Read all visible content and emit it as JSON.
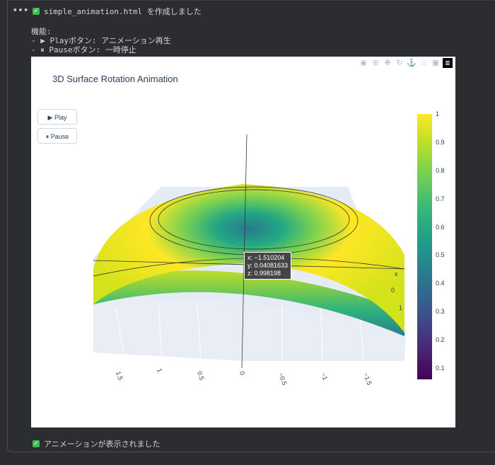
{
  "output": {
    "more": "•••",
    "status_line": "simple_animation.html を作成しました",
    "features_header": "機能:",
    "feature_items": [
      "- ▶ Playボタン: アニメーション再生",
      "- ⏸ Pauseボタン: 一時停止"
    ],
    "final_status": "アニメーションが表示されました"
  },
  "plot": {
    "title": "3D Surface Rotation Animation",
    "play_label": "▶ Play",
    "pause_label": "⏸ Pause",
    "modebar_icons": [
      "camera-icon",
      "zoom-icon",
      "pan-icon",
      "orbit-icon",
      "turntable-icon",
      "home-icon",
      "video-icon",
      "plotly-logo-icon"
    ],
    "axis_x_label": "x",
    "tooltip": "x: −1.510204\ny: 0.04081633\nz: 0.998198",
    "colorbar_ticks": [
      "1",
      "0.9",
      "0.8",
      "0.7",
      "0.6",
      "0.5",
      "0.4",
      "0.3",
      "0.2",
      "0.1"
    ],
    "axis_ticks": [
      "1.5",
      "1",
      "0.5",
      "0",
      "−0.5",
      "−1",
      "−1.5"
    ],
    "side_ticks": [
      "0",
      "1"
    ]
  },
  "chart_data": {
    "type": "surface",
    "title": "3D Surface Rotation Animation",
    "colorscale": "viridis",
    "colorbar_range": [
      0.1,
      1
    ],
    "axis_ticks": [
      1.5,
      1,
      0.5,
      0,
      -0.5,
      -1,
      -1.5
    ],
    "hover_point": {
      "x": -1.510204,
      "y": 0.04081633,
      "z": 0.998198
    }
  }
}
